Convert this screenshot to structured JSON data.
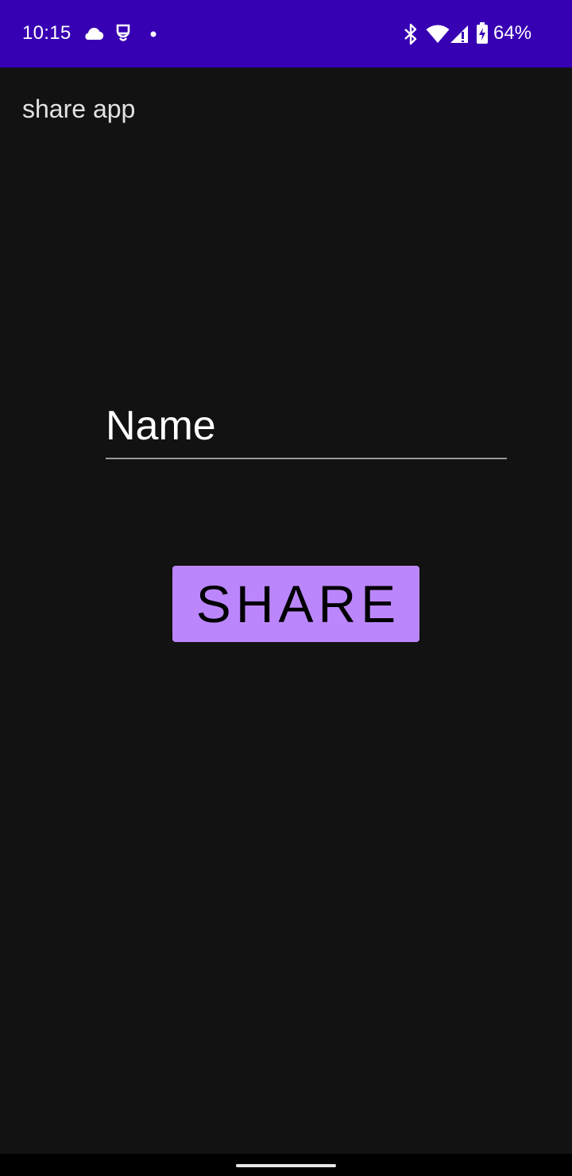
{
  "status_bar": {
    "time": "10:15",
    "battery_percent": "64%",
    "background_color": "#3700b3",
    "icons": [
      "cloud-icon",
      "vpn-icon",
      "notification-dot-icon",
      "bluetooth-icon",
      "wifi-icon",
      "signal-icon",
      "battery-charging-icon"
    ]
  },
  "app_bar": {
    "title": "share app"
  },
  "form": {
    "name_value": "Name",
    "share_label": "SHARE",
    "accent_color": "#bb86fc"
  },
  "theme": {
    "background": "#121212"
  }
}
